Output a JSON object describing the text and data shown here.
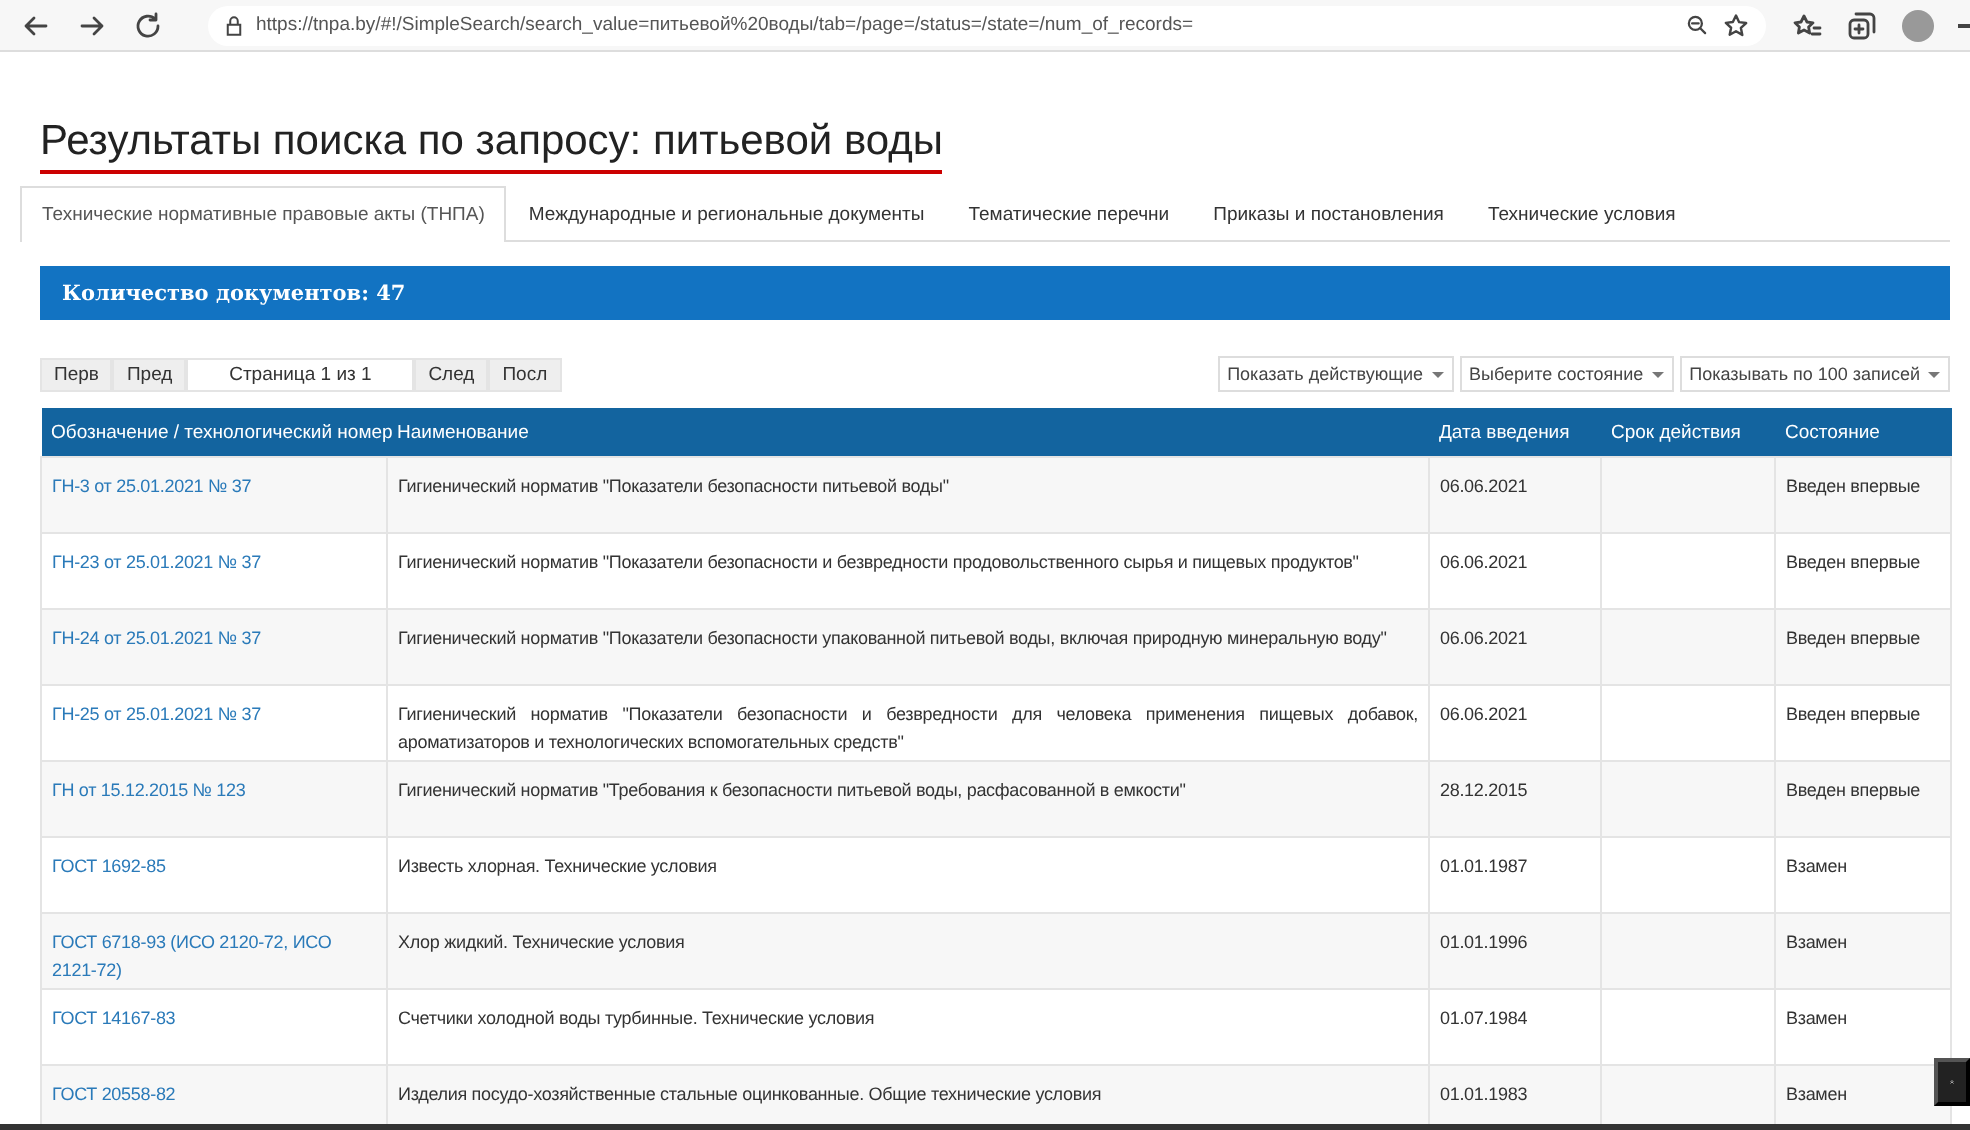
{
  "browser": {
    "url": "https://tnpa.by/#!/SimpleSearch/search_value=питьевой%20воды/tab=/page=/status=/state=/num_of_records="
  },
  "title": "Результаты поиска по запросу: питьевой воды",
  "tabs": [
    {
      "label": "Технические нормативные правовые акты (ТНПА)",
      "selected": true
    },
    {
      "label": "Международные и региональные документы",
      "selected": false
    },
    {
      "label": "Тематические перечни",
      "selected": false
    },
    {
      "label": "Приказы и постановления",
      "selected": false
    },
    {
      "label": "Технические условия",
      "selected": false
    }
  ],
  "count_banner": "Количество документов: 47",
  "pager": {
    "first": "Перв",
    "prev": "Пред",
    "page": "Страница 1 из 1",
    "next": "След",
    "last": "Посл"
  },
  "filters": [
    "Показать действующие",
    "Выберите состояние",
    "Показывать по 100 записей"
  ],
  "table": {
    "columns": [
      "Обозначение / технологический номер",
      "Наименование",
      "Дата введения",
      "Срок действия",
      "Состояние"
    ],
    "rows": [
      {
        "designation": "ГН-3 от 25.01.2021 № 37",
        "name": "Гигиенический норматив \"Показатели безопасности питьевой воды\"",
        "date": "06.06.2021",
        "status": "Введен впервые"
      },
      {
        "designation": "ГН-23 от 25.01.2021 № 37",
        "name": "Гигиенический норматив \"Показатели безопасности и безвредности продовольственного сырья и пищевых продуктов\"",
        "date": "06.06.2021",
        "status": "Введен впервые"
      },
      {
        "designation": "ГН-24 от 25.01.2021 № 37",
        "name": "Гигиенический норматив \"Показатели безопасности упакованной питьевой воды, включая природную минеральную воду\"",
        "date": "06.06.2021",
        "status": "Введен впервые"
      },
      {
        "designation": "ГН-25 от 25.01.2021 № 37",
        "name": "Гигиенический норматив \"Показатели безопасности и безвредности для человека применения пищевых добавок, ароматизаторов и технологических вспомогательных средств\"",
        "date": "06.06.2021",
        "status": "Введен впервые"
      },
      {
        "designation": "ГН от 15.12.2015 № 123",
        "name": "Гигиенический норматив \"Требования к безопасности питьевой воды, расфасованной в емкости\"",
        "date": "28.12.2015",
        "status": "Введен впервые"
      },
      {
        "designation": "ГОСТ 1692-85",
        "name": "Известь хлорная. Технические условия",
        "date": "01.01.1987",
        "status": "Взамен"
      },
      {
        "designation": "ГОСТ 6718-93 (ИСО 2120-72, ИСО 2121-72)",
        "name": "Хлор жидкий. Технические условия",
        "date": "01.01.1996",
        "status": "Взамен"
      },
      {
        "designation": "ГОСТ 14167-83",
        "name": "Счетчики холодной воды турбинные. Технические условия",
        "date": "01.07.1984",
        "status": "Взамен"
      },
      {
        "designation": "ГОСТ 20558-82",
        "name": "Изделия посудо-хозяйственные стальные оцинкованные. Общие технические условия",
        "date": "01.01.1983",
        "status": "Взамен"
      }
    ]
  }
}
